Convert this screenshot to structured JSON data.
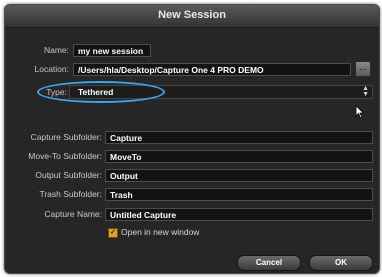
{
  "window": {
    "title": "New Session"
  },
  "fields": {
    "name": {
      "label": "Name:",
      "value": "my new session"
    },
    "location": {
      "label": "Location:",
      "value": "/Users/hla/Desktop/Capture One 4 PRO DEMO",
      "browse_label": "..."
    },
    "type": {
      "label": "Type:",
      "value": "Tethered"
    },
    "capture_subfolder": {
      "label": "Capture Subfolder:",
      "value": "Capture"
    },
    "move_to_subfolder": {
      "label": "Move-To Subfolder:",
      "value": "MoveTo"
    },
    "output_subfolder": {
      "label": "Output Subfolder:",
      "value": "Output"
    },
    "trash_subfolder": {
      "label": "Trash Subfolder:",
      "value": "Trash"
    },
    "capture_name": {
      "label": "Capture Name:",
      "value": "Untitled Capture"
    }
  },
  "open_in_new_window": {
    "label": "Open in new window",
    "checked": true
  },
  "buttons": {
    "cancel": "Cancel",
    "ok": "OK"
  },
  "colors": {
    "highlight": "#3aa7ef",
    "checkbox": "#e0a22a",
    "panel": "#262626"
  },
  "icons": {
    "cursor": "arrow-cursor-icon",
    "select_arrows": "updown-arrows-icon"
  }
}
